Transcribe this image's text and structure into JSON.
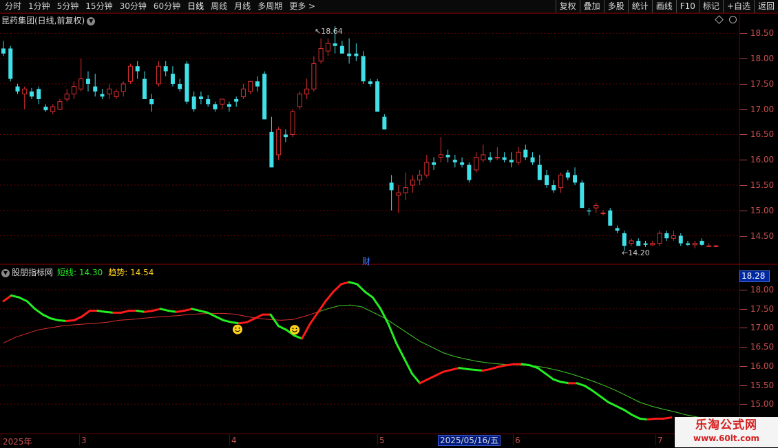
{
  "toolbar": {
    "periods": [
      "分时",
      "1分钟",
      "5分钟",
      "15分钟",
      "30分钟",
      "60分钟",
      "日线",
      "周线",
      "月线",
      "多周期",
      "更多 >"
    ],
    "active_period": "日线",
    "right_buttons": [
      "复权",
      "叠加",
      "多股",
      "统计",
      "画线",
      "F10",
      "标记",
      "+自选",
      "返回"
    ]
  },
  "main_chart": {
    "title": "昆药集团(日线,前复权)",
    "price_axis": [
      "18.50",
      "18.00",
      "17.50",
      "17.00",
      "16.50",
      "16.00",
      "15.50",
      "15.00",
      "14.50"
    ],
    "high_label": "18.64",
    "low_label": "14.20",
    "event_marker": "财"
  },
  "indicator": {
    "name": "股朋指标网",
    "short_label": "短线: 14.30",
    "trend_label": "趋势: 14.54",
    "current_value": "18.28",
    "axis": [
      "18.00",
      "17.50",
      "17.00",
      "16.50",
      "16.00",
      "15.50",
      "15.00"
    ]
  },
  "date_axis": {
    "labels": [
      "2025年",
      "3",
      "4",
      "5",
      "6",
      "7"
    ],
    "cursor_date": "2025/05/16/五"
  },
  "watermark": {
    "name": "乐淘公式网",
    "url": "www.60lt.com"
  },
  "colors": {
    "up": "#e03030",
    "down": "#40e0e8",
    "short_down": "#22ee22",
    "short_up": "#ff1a1a",
    "trend": "#e03030",
    "trend2": "#22c822",
    "grid": "#6a0000"
  },
  "chart_data": {
    "type": "candlestick",
    "candles": [
      [
        18.2,
        18.35,
        18.05,
        18.1
      ],
      [
        18.2,
        18.25,
        17.55,
        17.6
      ],
      [
        17.45,
        17.5,
        17.3,
        17.35
      ],
      [
        17.3,
        17.45,
        17.0,
        17.4
      ],
      [
        17.35,
        17.42,
        17.2,
        17.25
      ],
      [
        17.4,
        17.45,
        17.1,
        17.2
      ],
      [
        17.05,
        17.1,
        16.95,
        16.98
      ],
      [
        16.95,
        17.1,
        16.9,
        17.05
      ],
      [
        17.0,
        17.2,
        16.98,
        17.15
      ],
      [
        17.2,
        17.4,
        17.15,
        17.3
      ],
      [
        17.3,
        17.55,
        17.2,
        17.45
      ],
      [
        17.4,
        18.0,
        17.35,
        17.6
      ],
      [
        17.6,
        17.75,
        17.35,
        17.5
      ],
      [
        17.45,
        17.7,
        17.25,
        17.35
      ],
      [
        17.3,
        17.4,
        17.2,
        17.25
      ],
      [
        17.3,
        17.5,
        17.2,
        17.4
      ],
      [
        17.25,
        17.4,
        17.2,
        17.35
      ],
      [
        17.35,
        17.55,
        17.25,
        17.5
      ],
      [
        17.55,
        17.9,
        17.5,
        17.85
      ],
      [
        17.85,
        17.95,
        17.6,
        17.75
      ],
      [
        17.6,
        17.75,
        17.25,
        17.2
      ],
      [
        17.2,
        17.3,
        16.95,
        17.1
      ],
      [
        17.5,
        17.95,
        17.45,
        17.85
      ],
      [
        17.85,
        17.95,
        17.65,
        17.75
      ],
      [
        17.7,
        17.85,
        17.45,
        17.5
      ],
      [
        17.5,
        17.6,
        17.35,
        17.4
      ],
      [
        17.9,
        17.95,
        17.1,
        17.15
      ],
      [
        17.25,
        17.35,
        16.95,
        17.0
      ],
      [
        17.25,
        17.35,
        17.1,
        17.2
      ],
      [
        17.2,
        17.28,
        17.05,
        17.1
      ],
      [
        17.1,
        17.15,
        16.95,
        17.0
      ],
      [
        17.1,
        17.2,
        17.0,
        17.2
      ],
      [
        17.1,
        17.15,
        16.95,
        17.05
      ],
      [
        17.2,
        17.25,
        17.05,
        17.15
      ],
      [
        17.25,
        17.5,
        17.2,
        17.4
      ],
      [
        17.35,
        17.55,
        17.3,
        17.55
      ],
      [
        17.55,
        17.65,
        17.35,
        17.45
      ],
      [
        17.7,
        17.75,
        16.8,
        16.8
      ],
      [
        16.55,
        16.85,
        16.0,
        15.85
      ],
      [
        16.1,
        16.65,
        16.0,
        16.6
      ],
      [
        16.5,
        16.6,
        16.35,
        16.45
      ],
      [
        16.5,
        17.0,
        16.45,
        16.95
      ],
      [
        17.05,
        17.35,
        17.0,
        17.3
      ],
      [
        17.3,
        17.6,
        17.2,
        17.4
      ],
      [
        17.4,
        18.05,
        17.35,
        17.9
      ],
      [
        17.95,
        18.4,
        17.9,
        18.2
      ],
      [
        18.15,
        18.4,
        18.05,
        18.3
      ],
      [
        18.3,
        18.64,
        18.1,
        18.25
      ],
      [
        18.25,
        18.35,
        18.1,
        18.1
      ],
      [
        18.1,
        18.4,
        17.9,
        18.05
      ],
      [
        18.1,
        18.3,
        17.95,
        18.05
      ],
      [
        18.05,
        18.15,
        17.5,
        17.55
      ],
      [
        17.55,
        17.6,
        17.45,
        17.5
      ],
      [
        17.55,
        17.6,
        16.95,
        16.95
      ],
      [
        16.85,
        16.9,
        16.6,
        16.6
      ],
      [
        15.55,
        15.7,
        15.0,
        15.4
      ],
      [
        15.3,
        15.5,
        14.95,
        15.35
      ],
      [
        15.35,
        15.75,
        15.2,
        15.45
      ],
      [
        15.5,
        15.7,
        15.35,
        15.6
      ],
      [
        15.6,
        15.8,
        15.5,
        15.7
      ],
      [
        15.7,
        16.1,
        15.65,
        15.95
      ],
      [
        15.95,
        16.05,
        15.8,
        15.9
      ],
      [
        16.05,
        16.45,
        15.95,
        16.1
      ],
      [
        16.1,
        16.2,
        15.95,
        16.05
      ],
      [
        16.0,
        16.1,
        15.85,
        15.95
      ],
      [
        15.95,
        16.05,
        15.85,
        15.9
      ],
      [
        15.9,
        15.95,
        15.55,
        15.6
      ],
      [
        15.8,
        16.15,
        15.75,
        16.05
      ],
      [
        16.0,
        16.3,
        15.95,
        16.1
      ],
      [
        16.05,
        16.15,
        15.95,
        16.0
      ],
      [
        16.05,
        16.25,
        16.0,
        16.05
      ],
      [
        16.05,
        16.15,
        15.95,
        16.0
      ],
      [
        16.0,
        16.15,
        15.85,
        15.95
      ],
      [
        15.95,
        16.25,
        15.9,
        16.15
      ],
      [
        16.2,
        16.3,
        16.0,
        16.05
      ],
      [
        16.05,
        16.15,
        15.9,
        15.95
      ],
      [
        15.9,
        16.1,
        15.6,
        15.6
      ],
      [
        15.7,
        15.8,
        15.45,
        15.5
      ],
      [
        15.5,
        15.6,
        15.35,
        15.4
      ],
      [
        15.45,
        15.75,
        15.35,
        15.7
      ],
      [
        15.75,
        15.8,
        15.6,
        15.65
      ],
      [
        15.7,
        15.85,
        15.5,
        15.55
      ],
      [
        15.55,
        15.6,
        15.05,
        15.05
      ],
      [
        15.0,
        15.05,
        14.9,
        14.98
      ],
      [
        15.05,
        15.15,
        14.95,
        15.1
      ],
      [
        14.95,
        15.0,
        14.9,
        14.95
      ],
      [
        15.0,
        15.05,
        14.7,
        14.7
      ],
      [
        14.65,
        14.7,
        14.55,
        14.6
      ],
      [
        14.55,
        14.6,
        14.2,
        14.3
      ],
      [
        14.35,
        14.45,
        14.3,
        14.4
      ],
      [
        14.4,
        14.45,
        14.3,
        14.3
      ],
      [
        14.35,
        14.4,
        14.28,
        14.32
      ],
      [
        14.32,
        14.4,
        14.3,
        14.35
      ],
      [
        14.35,
        14.6,
        14.3,
        14.55
      ],
      [
        14.55,
        14.6,
        14.4,
        14.45
      ],
      [
        14.45,
        14.6,
        14.4,
        14.5
      ],
      [
        14.5,
        14.55,
        14.3,
        14.35
      ],
      [
        14.35,
        14.4,
        14.3,
        14.32
      ],
      [
        14.32,
        14.4,
        14.25,
        14.35
      ],
      [
        14.4,
        14.45,
        14.3,
        14.32
      ],
      [
        14.3,
        14.35,
        14.28,
        14.3
      ],
      [
        14.3,
        14.32,
        14.28,
        14.3
      ]
    ],
    "indicator_short": [
      17.7,
      17.85,
      17.8,
      17.7,
      17.5,
      17.35,
      17.25,
      17.2,
      17.18,
      17.2,
      17.3,
      17.45,
      17.45,
      17.42,
      17.4,
      17.4,
      17.45,
      17.45,
      17.42,
      17.45,
      17.5,
      17.45,
      17.42,
      17.45,
      17.5,
      17.45,
      17.4,
      17.3,
      17.2,
      17.15,
      17.12,
      17.15,
      17.25,
      17.35,
      17.35,
      17.05,
      16.95,
      16.8,
      16.72,
      17.1,
      17.4,
      17.7,
      17.95,
      18.15,
      18.2,
      18.15,
      17.95,
      17.8,
      17.5,
      17.1,
      16.6,
      16.2,
      15.8,
      15.55,
      15.65,
      15.75,
      15.85,
      15.9,
      15.95,
      15.92,
      15.9,
      15.88,
      15.92,
      15.98,
      16.02,
      16.05,
      16.05,
      16.02,
      15.95,
      15.8,
      15.65,
      15.58,
      15.55,
      15.55,
      15.48,
      15.35,
      15.2,
      15.05,
      14.95,
      14.85,
      14.72,
      14.62,
      14.6,
      14.62,
      14.62,
      14.65
    ],
    "indicator_trend": [
      16.6,
      16.75,
      16.85,
      16.95,
      17.0,
      17.05,
      17.08,
      17.1,
      17.12,
      17.15,
      17.2,
      17.22,
      17.25,
      17.28,
      17.3,
      17.32,
      17.35,
      17.37,
      17.38,
      17.38,
      17.36,
      17.3,
      17.25,
      17.22,
      17.2,
      17.22,
      17.3,
      17.4,
      17.5,
      17.58,
      17.6,
      17.55,
      17.4,
      17.25,
      17.05,
      16.85,
      16.65,
      16.5,
      16.35,
      16.25,
      16.18,
      16.12,
      16.08,
      16.05,
      16.03,
      16.02,
      16.0,
      15.95,
      15.88,
      15.8,
      15.7,
      15.6,
      15.48,
      15.35,
      15.2,
      15.05,
      14.95,
      14.87,
      14.8,
      14.72,
      14.66,
      14.6
    ],
    "smile_markers": [
      16.96,
      16.95
    ],
    "price_range": [
      14.1,
      18.75
    ],
    "indicator_range": [
      14.5,
      18.2
    ]
  }
}
